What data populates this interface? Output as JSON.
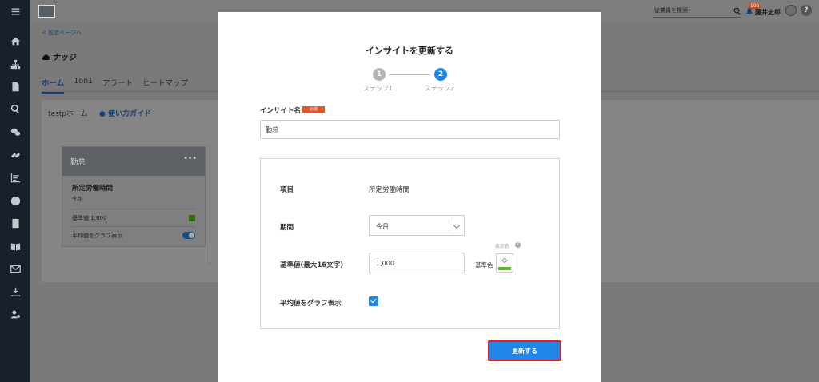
{
  "header": {
    "search_placeholder": "従業員を検索",
    "notification_count": "100",
    "user_name": "藤井史郎",
    "help_label": "?"
  },
  "page": {
    "back_link": "< 設定ページへ",
    "title": "ナッジ",
    "tabs": [
      "ホーム",
      "1on1",
      "アラート",
      "ヒートマップ"
    ],
    "panel_title": "testpホーム",
    "guide_link": "使い方ガイド"
  },
  "card": {
    "title": "勤怠",
    "menu": "•••",
    "metric": "所定労働時間",
    "period": "今月",
    "base_value": "基準値:1,000",
    "avg_label": "平均値をグラフ表示"
  },
  "modal": {
    "title": "インサイトを更新する",
    "steps": [
      {
        "number": "1",
        "label": "ステップ1"
      },
      {
        "number": "2",
        "label": "ステップ2"
      }
    ],
    "name_label": "インサイト名",
    "required_badge": "必須",
    "name_value": "勤怠",
    "fields": {
      "item_label": "項目",
      "item_value": "所定労働時間",
      "period_label": "期間",
      "period_value": "今月",
      "base_label": "基準値(最大16文字)",
      "base_value": "1,000",
      "display_color_label": "表示色",
      "base_color_label": "基準色",
      "avg_label": "平均値をグラフ表示",
      "avg_checked": true
    },
    "submit_label": "更新する"
  },
  "colors": {
    "primary": "#1e87e8",
    "required": "#e0552a",
    "swatch": "#5cb82c",
    "highlight_border": "#e02020"
  }
}
